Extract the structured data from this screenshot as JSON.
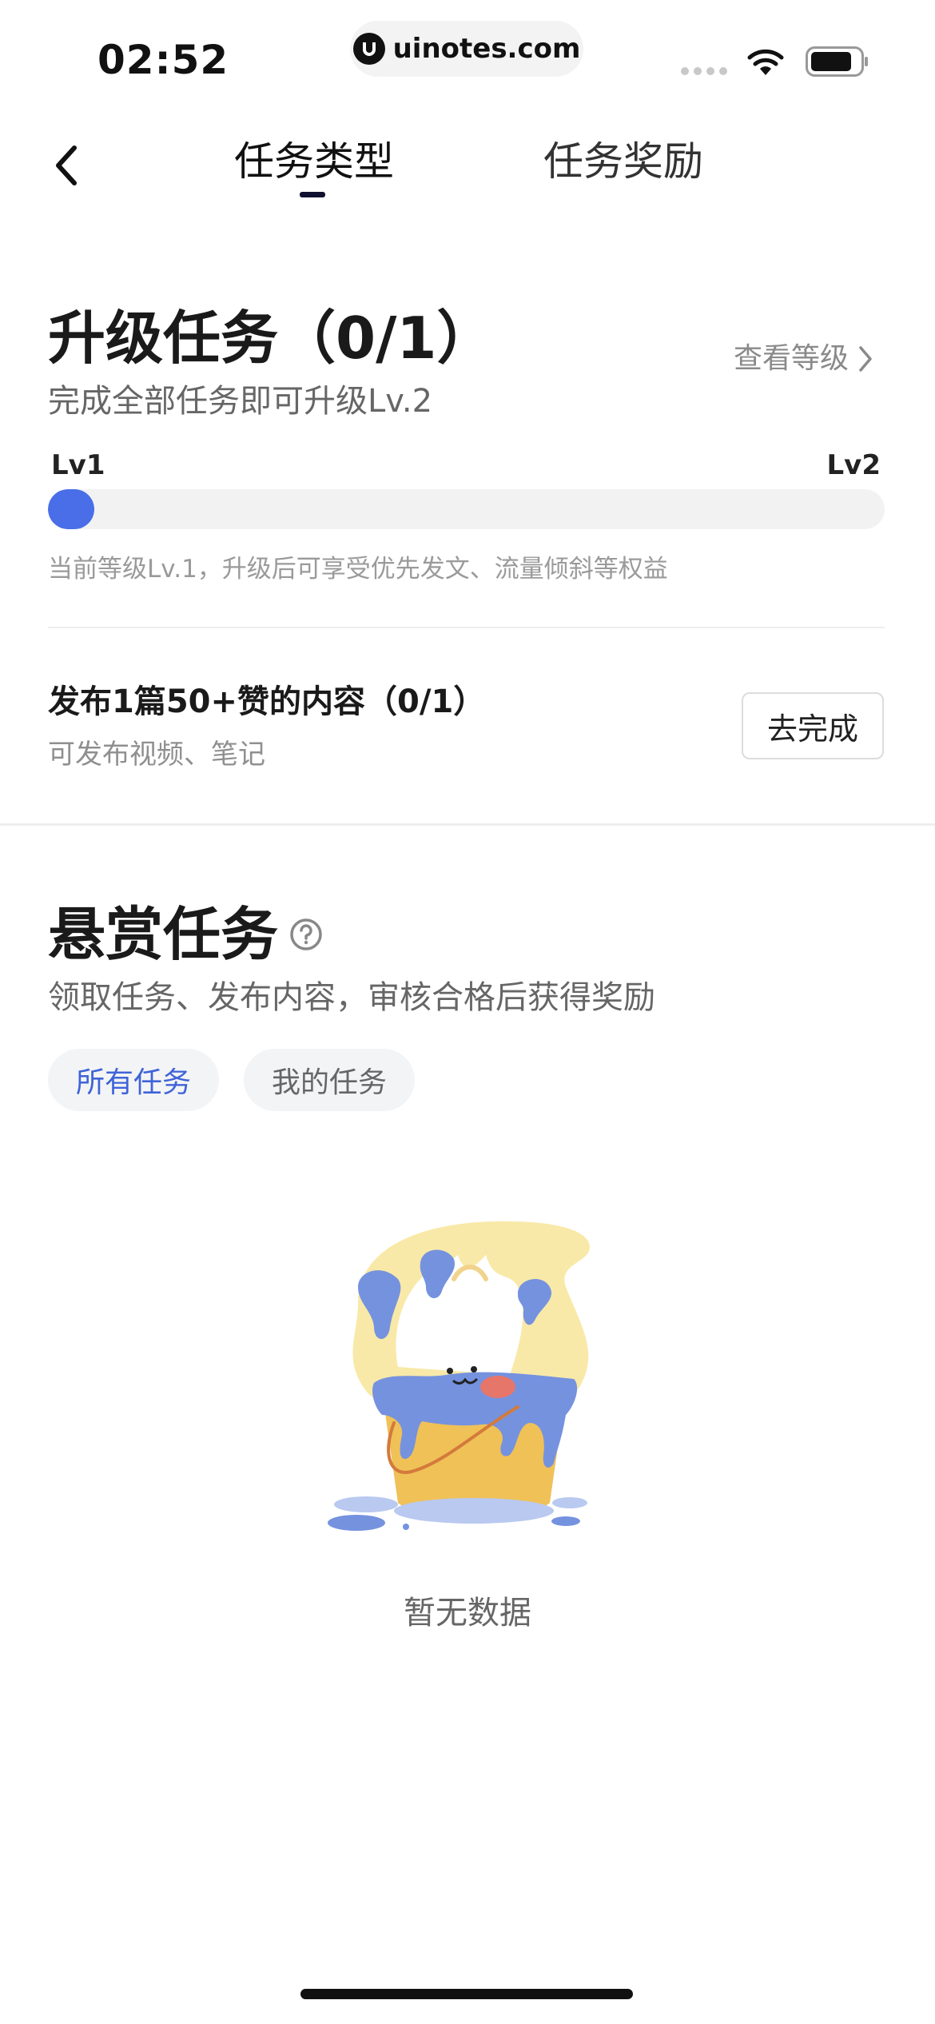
{
  "status_bar": {
    "time": "02:52",
    "url": "uinotes.com"
  },
  "nav": {
    "tabs": [
      {
        "label": "任务类型",
        "active": true
      },
      {
        "label": "任务奖励",
        "active": false
      }
    ]
  },
  "upgrade": {
    "title": "升级任务（0/1）",
    "view_level": "查看等级",
    "subtitle": "完成全部任务即可升级Lv.2",
    "level_start": "Lv1",
    "level_end": "Lv2",
    "progress_fraction": 0.035,
    "hint": "当前等级Lv.1，升级后可享受优先发文、流量倾斜等权益",
    "task": {
      "title": "发布1篇50+赞的内容（0/1）",
      "desc": "可发布视频、笔记",
      "button": "去完成"
    }
  },
  "bounty": {
    "title": "悬赏任务",
    "subtitle": "领取任务、发布内容，审核合格后获得奖励",
    "chips": [
      {
        "label": "所有任务",
        "active": true
      },
      {
        "label": "我的任务",
        "active": false
      }
    ],
    "empty_text": "暂无数据"
  },
  "colors": {
    "accent": "#4a6ee8",
    "chip_active_text": "#3f63d8"
  },
  "icons": [
    "back-arrow-icon",
    "chevron-right-icon",
    "help-circle-icon",
    "wifi-icon",
    "battery-icon",
    "empty-bucket-illustration"
  ]
}
